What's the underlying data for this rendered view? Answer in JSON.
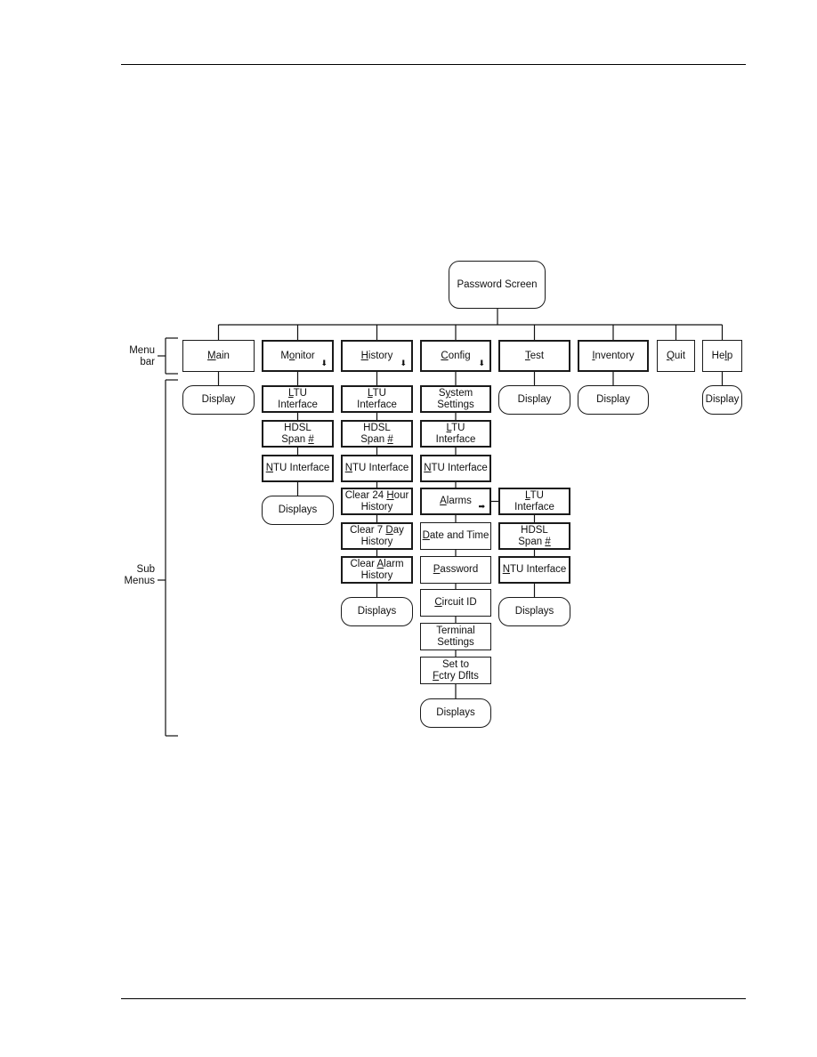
{
  "root": {
    "label": "Password Screen"
  },
  "side_labels": {
    "menu_bar": "Menu\nbar",
    "sub_menus": "Sub\nMenus"
  },
  "menus": [
    {
      "id": "main",
      "label": "Main",
      "hotkey": "M",
      "has_submenu_arrow": false,
      "children": [
        {
          "label": "Display",
          "type": "terminal"
        }
      ]
    },
    {
      "id": "monitor",
      "label": "Monitor",
      "hotkey": "o",
      "has_submenu_arrow": true,
      "children": [
        {
          "label": "LTU\nInterface",
          "hotkey": "L",
          "type": "item"
        },
        {
          "label": "HDSL\nSpan #",
          "hotkey": "#",
          "type": "item"
        },
        {
          "label": "NTU Interface",
          "hotkey": "N",
          "type": "item"
        },
        {
          "label": "Displays",
          "type": "terminal"
        }
      ]
    },
    {
      "id": "history",
      "label": "History",
      "hotkey": "H",
      "has_submenu_arrow": true,
      "children": [
        {
          "label": "LTU\nInterface",
          "hotkey": "L",
          "type": "item"
        },
        {
          "label": "HDSL\nSpan #",
          "hotkey": "#",
          "type": "item"
        },
        {
          "label": "NTU Interface",
          "hotkey": "N",
          "type": "item"
        },
        {
          "label": "Clear 24 Hour\nHistory",
          "hotkey": "H",
          "type": "item"
        },
        {
          "label": "Clear 7 Day\nHistory",
          "hotkey": "D",
          "type": "item"
        },
        {
          "label": "Clear Alarm\nHistory",
          "hotkey": "A",
          "type": "item"
        },
        {
          "label": "Displays",
          "type": "terminal"
        }
      ]
    },
    {
      "id": "config",
      "label": "Config",
      "hotkey": "C",
      "has_submenu_arrow": true,
      "children": [
        {
          "label": "System\nSettings",
          "hotkey": "y",
          "type": "item"
        },
        {
          "label": "LTU\nInterface",
          "hotkey": "L",
          "type": "item"
        },
        {
          "label": "NTU Interface",
          "hotkey": "N",
          "type": "item"
        },
        {
          "label": "Alarms",
          "hotkey": "A",
          "type": "item",
          "has_submenu_arrow": true
        },
        {
          "label": "Date and Time",
          "hotkey": "D",
          "type": "item"
        },
        {
          "label": "Password",
          "hotkey": "P",
          "type": "item"
        },
        {
          "label": "Circuit ID",
          "hotkey": "C",
          "type": "item"
        },
        {
          "label": "Terminal\nSettings",
          "hotkey": "g",
          "type": "item"
        },
        {
          "label": "Set to\nFctry Dflts",
          "hotkey": "F",
          "type": "item"
        },
        {
          "label": "Displays",
          "type": "terminal"
        }
      ]
    },
    {
      "id": "test",
      "label": "Test",
      "hotkey": "T",
      "has_submenu_arrow": false,
      "children": [
        {
          "label": "Display",
          "type": "terminal"
        }
      ]
    },
    {
      "id": "inventory",
      "label": "Inventory",
      "hotkey": "I",
      "has_submenu_arrow": false,
      "children": [
        {
          "label": "Display",
          "type": "terminal"
        }
      ]
    },
    {
      "id": "quit",
      "label": "Quit",
      "hotkey": "Q",
      "has_submenu_arrow": false,
      "children": []
    },
    {
      "id": "help",
      "label": "Help",
      "hotkey": "l",
      "has_submenu_arrow": false,
      "children": [
        {
          "label": "Display",
          "type": "terminal"
        }
      ]
    }
  ],
  "alarms_submenu": [
    {
      "label": "LTU\nInterface",
      "hotkey": "L",
      "type": "item"
    },
    {
      "label": "HDSL\nSpan #",
      "hotkey": "#",
      "type": "item"
    },
    {
      "label": "NTU Interface",
      "hotkey": "N",
      "type": "item"
    },
    {
      "label": "Displays",
      "type": "terminal"
    }
  ],
  "icons": {
    "submenu_down": "arrow-down-icon",
    "submenu_right": "arrow-right-icon"
  }
}
